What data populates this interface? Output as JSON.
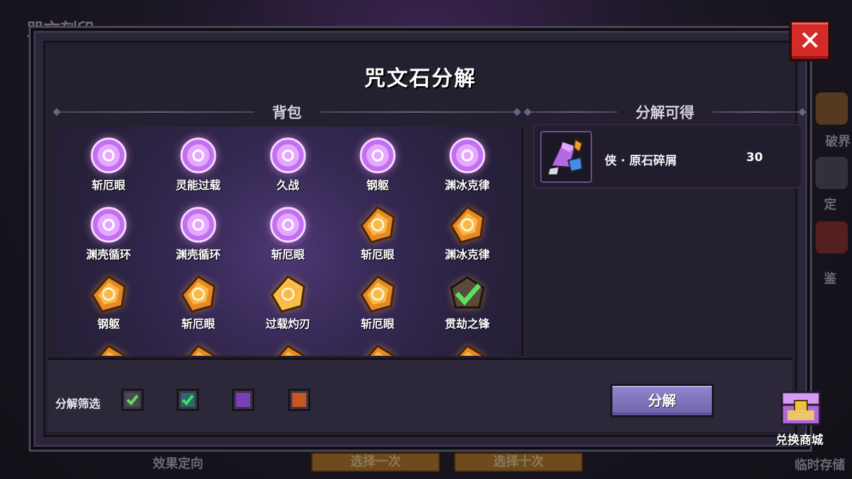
{
  "background": {
    "top_left_label": "咒文刻印",
    "bottom_left_label": "效果定向",
    "bottom_btn_1": "选择一次",
    "bottom_btn_2": "选择十次",
    "right_labels": [
      "破界",
      "定",
      "鉴"
    ],
    "bottom_right_label": "临时存储"
  },
  "dialog": {
    "title": "咒文石分解",
    "inventory_heading": "背包",
    "reward_heading": "分解可得",
    "close_icon": "close-icon"
  },
  "inventory": {
    "items": [
      {
        "name": "斩厄眼",
        "rarity": "purple"
      },
      {
        "name": "灵能过载",
        "rarity": "purple"
      },
      {
        "name": "久战",
        "rarity": "purple"
      },
      {
        "name": "钢躯",
        "rarity": "purple"
      },
      {
        "name": "渊冰克律",
        "rarity": "purple"
      },
      {
        "name": "渊壳循环",
        "rarity": "purple"
      },
      {
        "name": "渊壳循环",
        "rarity": "purple"
      },
      {
        "name": "斩厄眼",
        "rarity": "purple"
      },
      {
        "name": "斩厄眼",
        "rarity": "orange"
      },
      {
        "name": "渊冰克律",
        "rarity": "orange"
      },
      {
        "name": "钢躯",
        "rarity": "orange"
      },
      {
        "name": "斩厄眼",
        "rarity": "orange"
      },
      {
        "name": "过载灼刃",
        "rarity": "gold"
      },
      {
        "name": "斩厄眼",
        "rarity": "orange"
      },
      {
        "name": "贯劫之锋",
        "rarity": "special"
      },
      {
        "name": "",
        "rarity": "orange"
      },
      {
        "name": "",
        "rarity": "orange"
      },
      {
        "name": "",
        "rarity": "orange"
      },
      {
        "name": "",
        "rarity": "orange"
      },
      {
        "name": "",
        "rarity": "orange"
      }
    ]
  },
  "reward": {
    "name": "侠 · 原石碎屑",
    "count": "30"
  },
  "filter": {
    "label": "分解筛选",
    "options": [
      {
        "type": "special",
        "checked": true,
        "color": "#3c3747"
      },
      {
        "type": "green",
        "checked": true,
        "color": "#3c3747"
      },
      {
        "type": "purple",
        "checked": false,
        "color": "#7a3fb8"
      },
      {
        "type": "orange",
        "checked": false,
        "color": "#c9551f"
      }
    ]
  },
  "actions": {
    "decompose_label": "分解",
    "shop_label": "兑换商城"
  },
  "colors": {
    "purple_gem": "#d48cff",
    "orange_gem": "#f2a33a",
    "close_red": "#d42a2a",
    "button_purple": "#7d74bc"
  }
}
